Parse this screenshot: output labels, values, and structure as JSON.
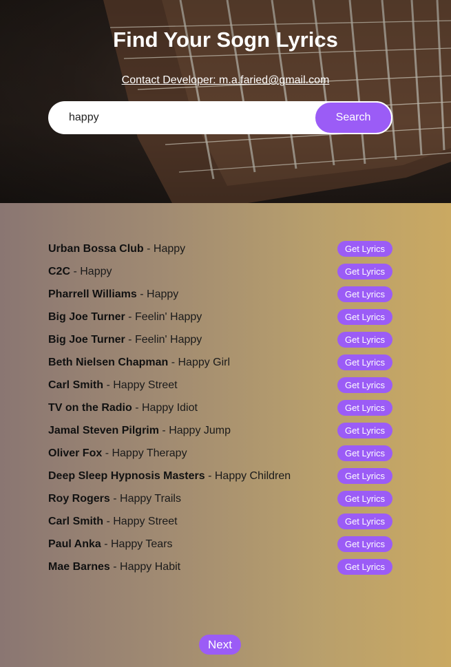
{
  "header": {
    "title": "Find Your Sogn Lyrics",
    "contact": "Contact Developer: m.a.faried@gmail.com",
    "background_image": "guitar-fretboard-image"
  },
  "search": {
    "value": "happy",
    "button_label": "Search"
  },
  "results": {
    "separator": " - ",
    "button_label": "Get Lyrics",
    "items": [
      {
        "artist": "Urban Bossa Club",
        "title": "Happy"
      },
      {
        "artist": "C2C",
        "title": "Happy"
      },
      {
        "artist": "Pharrell Williams",
        "title": "Happy"
      },
      {
        "artist": "Big Joe Turner",
        "title": "Feelin' Happy"
      },
      {
        "artist": "Big Joe Turner",
        "title": "Feelin' Happy"
      },
      {
        "artist": "Beth Nielsen Chapman",
        "title": "Happy Girl"
      },
      {
        "artist": "Carl Smith",
        "title": "Happy Street"
      },
      {
        "artist": "TV on the Radio",
        "title": "Happy Idiot"
      },
      {
        "artist": "Jamal Steven Pilgrim",
        "title": "Happy Jump"
      },
      {
        "artist": "Oliver Fox",
        "title": "Happy Therapy"
      },
      {
        "artist": "Deep Sleep Hypnosis Masters",
        "title": "Happy Children"
      },
      {
        "artist": "Roy Rogers",
        "title": "Happy Trails"
      },
      {
        "artist": "Carl Smith",
        "title": "Happy Street"
      },
      {
        "artist": "Paul Anka",
        "title": "Happy Tears"
      },
      {
        "artist": "Mae Barnes",
        "title": "Happy Habit"
      }
    ]
  },
  "pagination": {
    "next_label": "Next"
  },
  "colors": {
    "accent": "#9b5cf6",
    "gradient_start": "#8a7672",
    "gradient_end": "#caa962"
  }
}
